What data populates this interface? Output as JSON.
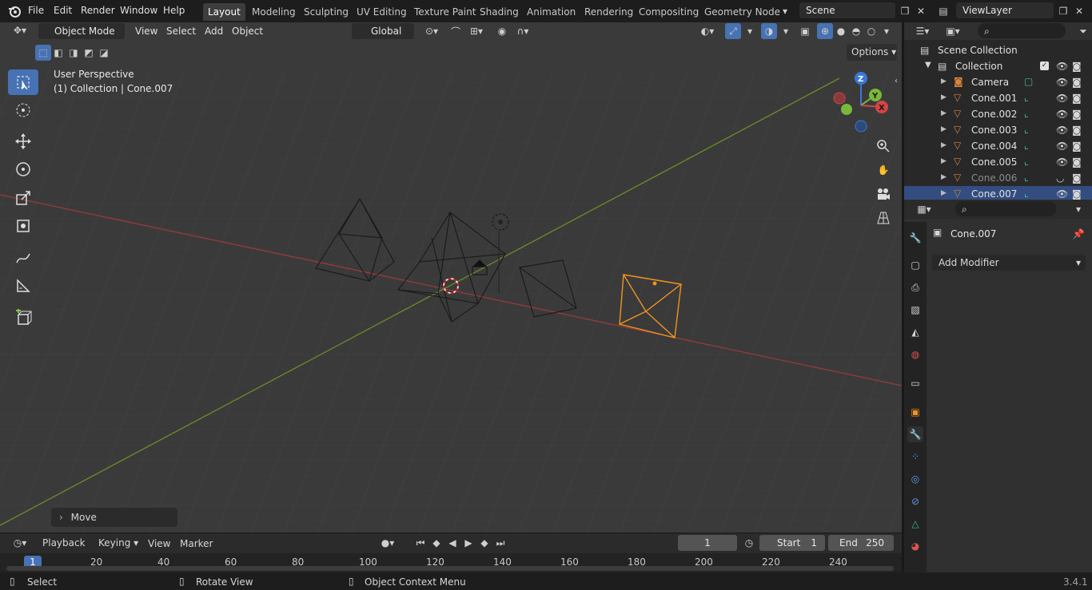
{
  "topbar": {
    "menus": [
      "File",
      "Edit",
      "Render",
      "Window",
      "Help"
    ],
    "workspaces": [
      "Layout",
      "Modeling",
      "Sculpting",
      "UV Editing",
      "Texture Paint",
      "Shading",
      "Animation",
      "Rendering",
      "Compositing",
      "Geometry Node"
    ],
    "active_workspace": "Layout",
    "scene": "Scene",
    "view_layer": "ViewLayer"
  },
  "viewport_header": {
    "mode": "Object Mode",
    "menus": [
      "View",
      "Select",
      "Add",
      "Object"
    ],
    "orientation": "Global",
    "options_label": "Options"
  },
  "viewport": {
    "perspective": "User Perspective",
    "context": "(1) Collection | Cone.007",
    "operator_panel": "Move",
    "gizmo": {
      "x": "X",
      "y": "Y",
      "z": "Z"
    }
  },
  "outliner": {
    "root": "Scene Collection",
    "collection": "Collection",
    "items": [
      {
        "name": "Camera",
        "selected": false
      },
      {
        "name": "Cone.001",
        "selected": false
      },
      {
        "name": "Cone.002",
        "selected": false
      },
      {
        "name": "Cone.003",
        "selected": false
      },
      {
        "name": "Cone.004",
        "selected": false
      },
      {
        "name": "Cone.005",
        "selected": false
      },
      {
        "name": "Cone.006",
        "selected": false
      },
      {
        "name": "Cone.007",
        "selected": true
      }
    ]
  },
  "properties": {
    "object_name": "Cone.007",
    "add_modifier": "Add Modifier"
  },
  "timeline": {
    "menus": [
      "Playback",
      "Keying",
      "View",
      "Marker"
    ],
    "current_frame": "1",
    "start_label": "Start",
    "start": "1",
    "end_label": "End",
    "end": "250",
    "ruler": [
      "1",
      "20",
      "40",
      "60",
      "80",
      "100",
      "120",
      "140",
      "160",
      "180",
      "200",
      "220",
      "240"
    ],
    "playhead_label": "1"
  },
  "status": {
    "select": "Select",
    "rotate": "Rotate View",
    "context_menu": "Object Context Menu",
    "version": "3.4.1"
  },
  "colors": {
    "accent": "#4772b3",
    "selected": "#f0941e",
    "x_axis": "#b33c3c",
    "y_axis": "#6f9a1f"
  }
}
